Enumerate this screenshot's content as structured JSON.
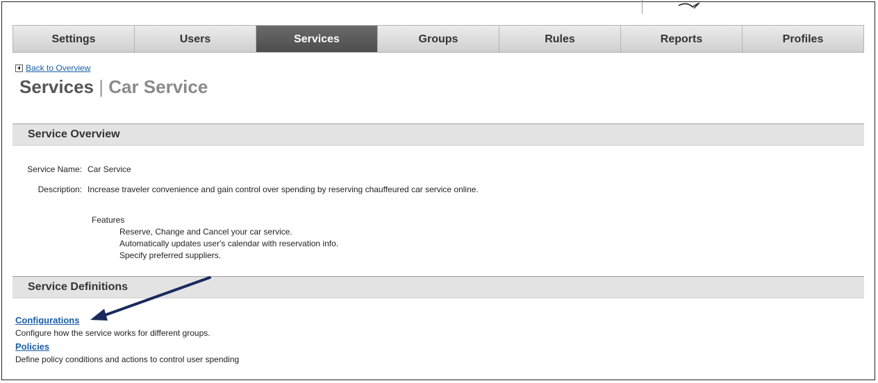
{
  "tabs": [
    {
      "label": "Settings",
      "active": false
    },
    {
      "label": "Users",
      "active": false
    },
    {
      "label": "Services",
      "active": true
    },
    {
      "label": "Groups",
      "active": false
    },
    {
      "label": "Rules",
      "active": false
    },
    {
      "label": "Reports",
      "active": false
    },
    {
      "label": "Profiles",
      "active": false
    }
  ],
  "back_link": "Back to Overview",
  "page_title": {
    "main": "Services",
    "separator": "|",
    "sub": "Car Service"
  },
  "overview": {
    "header": "Service Overview",
    "name_label": "Service Name:",
    "name_value": "Car Service",
    "description_label": "Description:",
    "description_value": "Increase traveler convenience and gain control over spending by reserving chauffeured car service online.",
    "features_title": "Features",
    "features": [
      "Reserve, Change and Cancel your car service.",
      "Automatically updates user's calendar with reservation info.",
      "Specify preferred suppliers."
    ]
  },
  "definitions": {
    "header": "Service Definitions",
    "items": [
      {
        "link": "Configurations",
        "description": "Configure how the service works for different groups."
      },
      {
        "link": "Policies",
        "description": "Define policy conditions and actions to control user spending"
      }
    ]
  },
  "colors": {
    "active_tab": "#4d4d4d",
    "link": "#1a5ea8",
    "arrow": "#1b2a5c"
  },
  "icons": {
    "back": "back-arrow-icon",
    "annotation": "callout-arrow-icon"
  }
}
